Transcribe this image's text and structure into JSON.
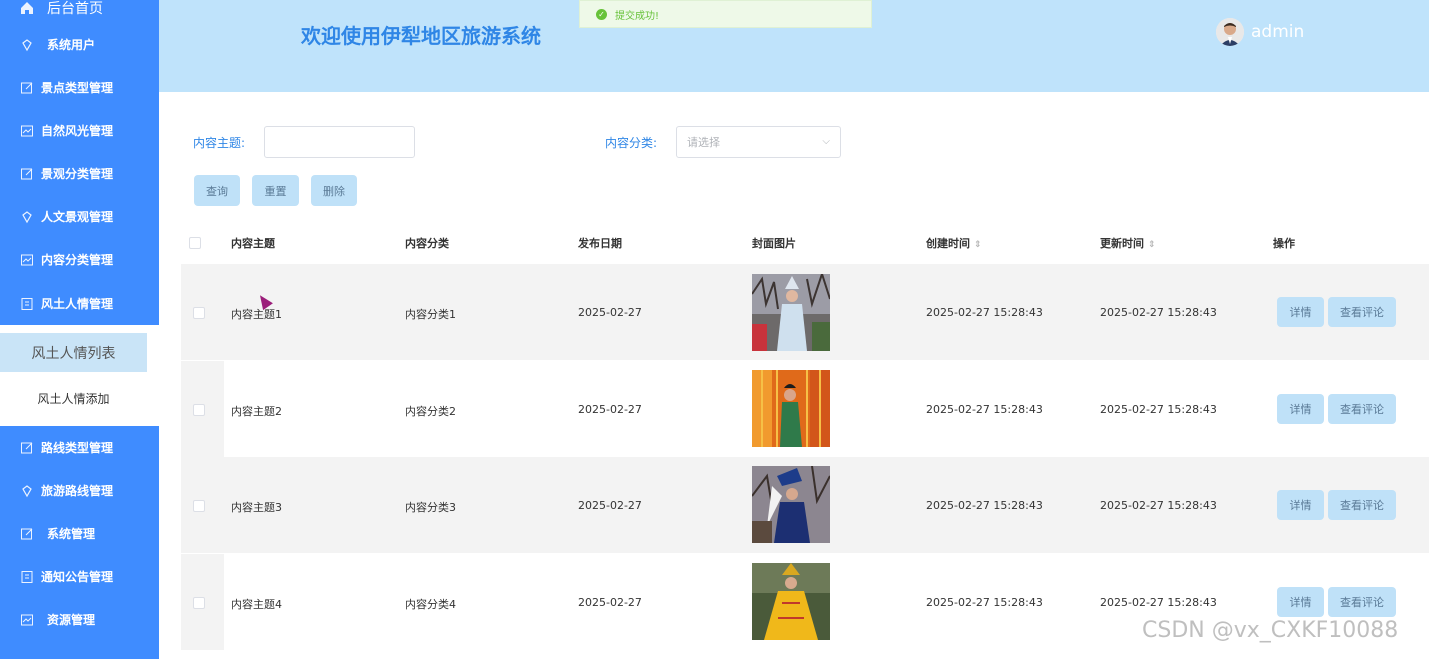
{
  "sidebar": {
    "top_partial": "后台首页",
    "items": [
      {
        "label": "系统用户",
        "icon": "diamond-icon"
      },
      {
        "label": "景点类型管理",
        "icon": "edit-icon"
      },
      {
        "label": "自然风光管理",
        "icon": "chart-icon"
      },
      {
        "label": "景观分类管理",
        "icon": "edit-icon"
      },
      {
        "label": "人文景观管理",
        "icon": "diamond-icon"
      },
      {
        "label": "内容分类管理",
        "icon": "chart-icon"
      },
      {
        "label": "风土人情管理",
        "icon": "book-icon"
      },
      {
        "label": "路线类型管理",
        "icon": "edit-icon"
      },
      {
        "label": "旅游路线管理",
        "icon": "diamond-icon"
      },
      {
        "label": "系统管理",
        "icon": "edit-icon"
      },
      {
        "label": "通知公告管理",
        "icon": "book-icon"
      },
      {
        "label": "资源管理",
        "icon": "chart-icon"
      }
    ],
    "sub_items": [
      {
        "label": "风土人情列表",
        "active": true
      },
      {
        "label": "风土人情添加",
        "active": false
      }
    ]
  },
  "header": {
    "title": "欢迎使用伊犁地区旅游系统",
    "username": "admin"
  },
  "toast": {
    "message": "提交成功!"
  },
  "search": {
    "topic_label": "内容主题:",
    "category_label": "内容分类:",
    "category_placeholder": "请选择",
    "query_btn": "查询",
    "reset_btn": "重置",
    "delete_btn": "删除"
  },
  "table": {
    "headers": {
      "topic": "内容主题",
      "category": "内容分类",
      "date": "发布日期",
      "cover": "封面图片",
      "created": "创建时间",
      "updated": "更新时间",
      "ops": "操作"
    },
    "rows": [
      {
        "topic": "内容主题1",
        "category": "内容分类1",
        "date": "2025-02-27",
        "created": "2025-02-27 15:28:43",
        "updated": "2025-02-27 15:28:43"
      },
      {
        "topic": "内容主题2",
        "category": "内容分类2",
        "date": "2025-02-27",
        "created": "2025-02-27 15:28:43",
        "updated": "2025-02-27 15:28:43"
      },
      {
        "topic": "内容主题3",
        "category": "内容分类3",
        "date": "2025-02-27",
        "created": "2025-02-27 15:28:43",
        "updated": "2025-02-27 15:28:43"
      },
      {
        "topic": "内容主题4",
        "category": "内容分类4",
        "date": "2025-02-27",
        "created": "2025-02-27 15:28:43",
        "updated": "2025-02-27 15:28:43"
      }
    ],
    "detail_btn": "详情",
    "comments_btn": "查看评论"
  },
  "watermark": "CSDN @vx_CXKF10088",
  "colors": {
    "sidebar": "#3f8cff",
    "header": "#bfe3fb",
    "title": "#2f86e6",
    "button": "#bfe1f8"
  }
}
